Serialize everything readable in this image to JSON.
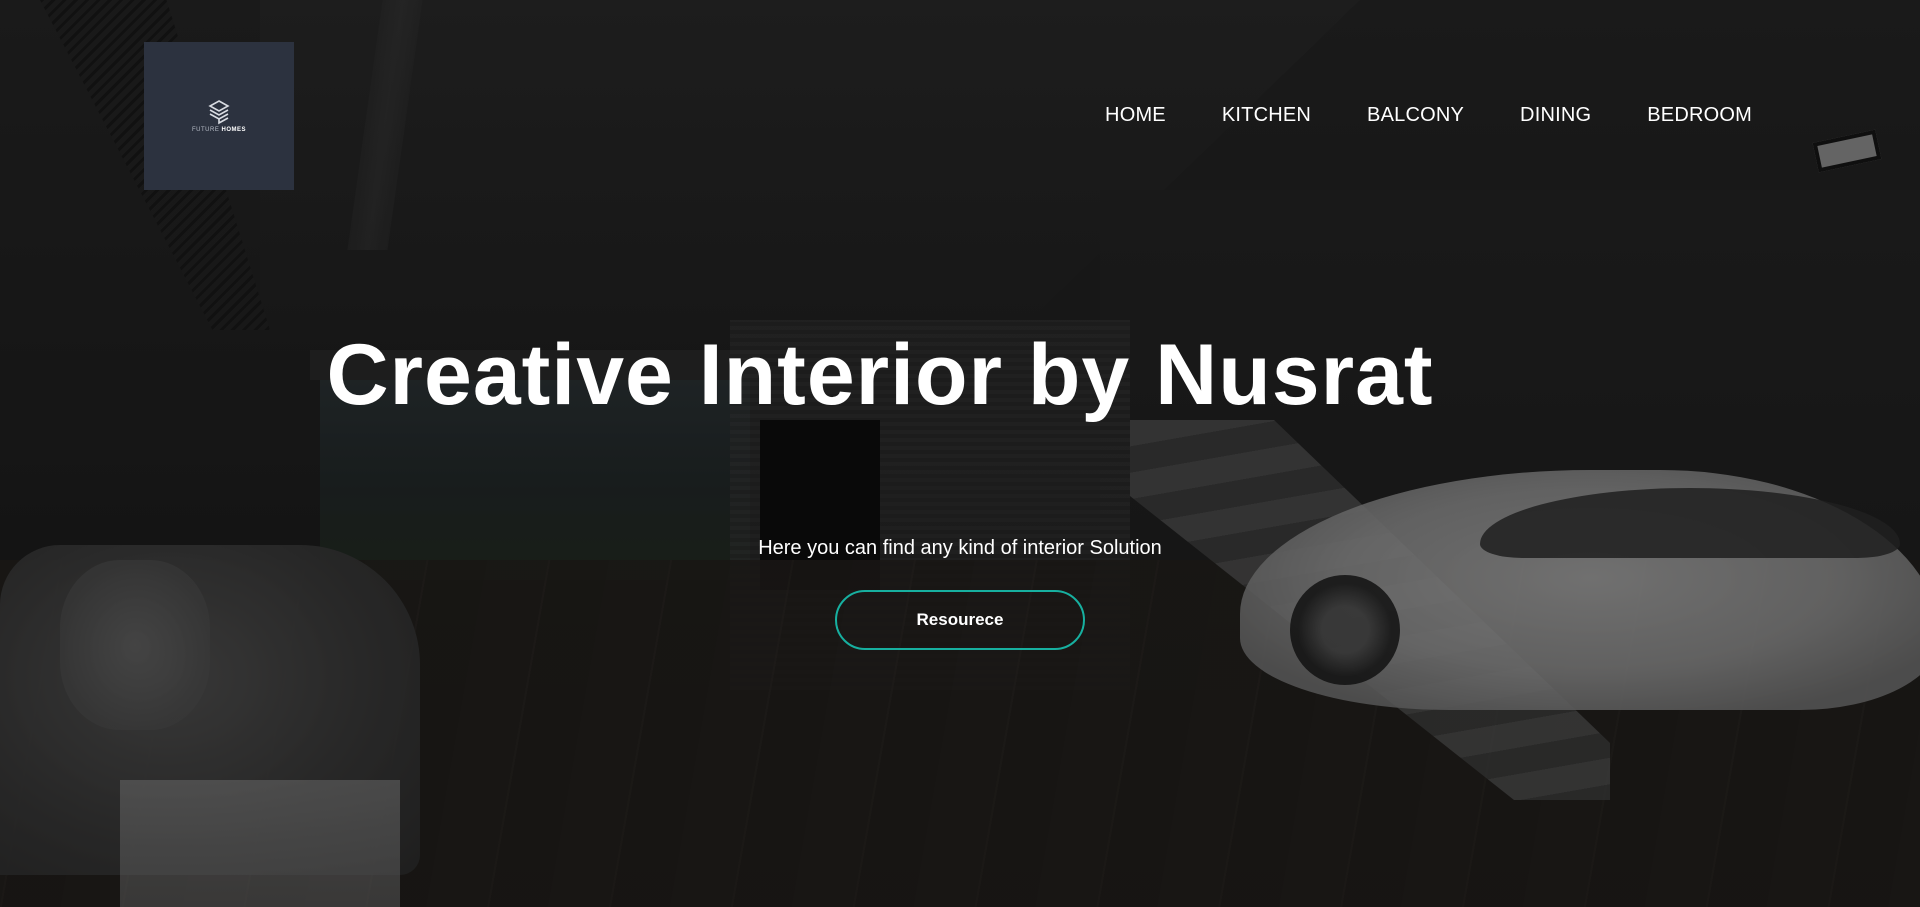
{
  "brand": {
    "logo_text_light": "FUTURE",
    "logo_text_bold": "HOMES",
    "logo_icon": "stacked-cube-icon",
    "logo_bg_color": "#2c323f"
  },
  "nav": {
    "items": [
      {
        "label": "HOME"
      },
      {
        "label": "KITCHEN"
      },
      {
        "label": "BALCONY"
      },
      {
        "label": "DINING"
      },
      {
        "label": "BEDROOM"
      }
    ]
  },
  "hero": {
    "headline": "Creative Interior by Nusrat",
    "subtitle": "Here you can find any kind of interior Solution",
    "cta_label": "Resourece",
    "cta_border_color": "#17b0a0"
  }
}
